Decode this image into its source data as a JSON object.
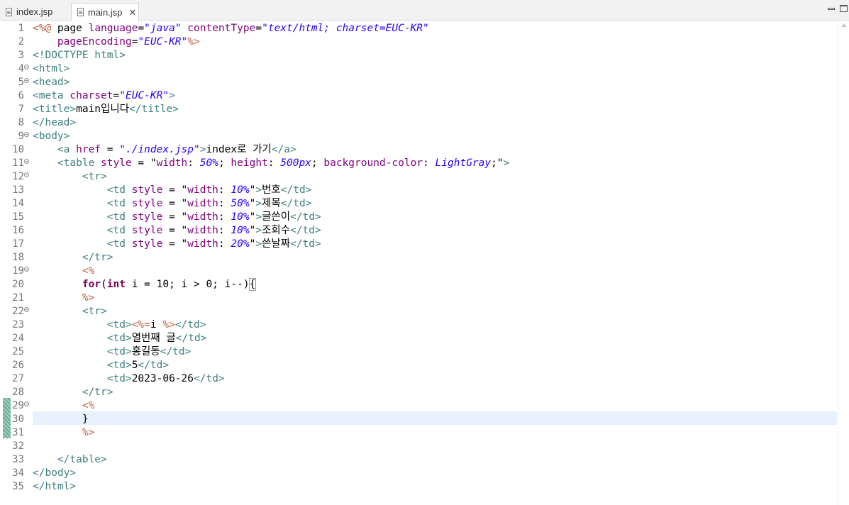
{
  "tabs": [
    {
      "label": "index.jsp",
      "active": false
    },
    {
      "label": "main.jsp",
      "active": true
    }
  ],
  "window_controls": [
    "minimize-icon",
    "maximize-icon"
  ],
  "icons": {
    "file": "file-icon",
    "close": "close-icon",
    "fold": "fold-toggle-icon"
  },
  "colors": {
    "tag": "#3f7f7f",
    "attribute": "#7f007f",
    "string": "#2a00ff",
    "directive": "#bf5f3f",
    "keyword": "#7f0055",
    "current_line": "#e8f2fe",
    "change_marker": "#6eaa98"
  },
  "editor": {
    "current_line_number": "30",
    "changed_lines": [
      "29",
      "30",
      "31"
    ],
    "lines": [
      {
        "num": "1",
        "fold": false,
        "tokens": [
          {
            "t": "<%@",
            "k": "dir"
          },
          {
            "t": " page ",
            "k": "plain"
          },
          {
            "t": "language",
            "k": "attr"
          },
          {
            "t": "=",
            "k": "plain"
          },
          {
            "t": "\"java\"",
            "k": "str"
          },
          {
            "t": " ",
            "k": "plain"
          },
          {
            "t": "contentType",
            "k": "attr"
          },
          {
            "t": "=",
            "k": "plain"
          },
          {
            "t": "\"text/html; charset=EUC-KR\"",
            "k": "str"
          }
        ]
      },
      {
        "num": "2",
        "fold": false,
        "tokens": [
          {
            "t": "    ",
            "k": "plain"
          },
          {
            "t": "pageEncoding",
            "k": "attr"
          },
          {
            "t": "=",
            "k": "plain"
          },
          {
            "t": "\"EUC-KR\"",
            "k": "str"
          },
          {
            "t": "%>",
            "k": "dir"
          }
        ]
      },
      {
        "num": "3",
        "fold": false,
        "tokens": [
          {
            "t": "<!DOCTYPE html>",
            "k": "tag"
          }
        ]
      },
      {
        "num": "4",
        "fold": true,
        "tokens": [
          {
            "t": "<html>",
            "k": "tag"
          }
        ]
      },
      {
        "num": "5",
        "fold": true,
        "tokens": [
          {
            "t": "<head>",
            "k": "tag"
          }
        ]
      },
      {
        "num": "6",
        "fold": false,
        "tokens": [
          {
            "t": "<meta ",
            "k": "tag"
          },
          {
            "t": "charset",
            "k": "attr"
          },
          {
            "t": "=",
            "k": "plain"
          },
          {
            "t": "\"EUC-KR\"",
            "k": "str"
          },
          {
            "t": ">",
            "k": "tag"
          }
        ]
      },
      {
        "num": "7",
        "fold": false,
        "tokens": [
          {
            "t": "<title>",
            "k": "tag"
          },
          {
            "t": "main입니다",
            "k": "plain"
          },
          {
            "t": "</title>",
            "k": "tag"
          }
        ]
      },
      {
        "num": "8",
        "fold": false,
        "tokens": [
          {
            "t": "</head>",
            "k": "tag"
          }
        ]
      },
      {
        "num": "9",
        "fold": true,
        "tokens": [
          {
            "t": "<body>",
            "k": "tag"
          }
        ]
      },
      {
        "num": "10",
        "fold": false,
        "tokens": [
          {
            "t": "    ",
            "k": "plain"
          },
          {
            "t": "<a ",
            "k": "tag"
          },
          {
            "t": "href",
            "k": "attr"
          },
          {
            "t": " = ",
            "k": "plain"
          },
          {
            "t": "\"./index.jsp\"",
            "k": "str"
          },
          {
            "t": ">",
            "k": "tag"
          },
          {
            "t": "index로 가기",
            "k": "plain"
          },
          {
            "t": "</a>",
            "k": "tag"
          }
        ]
      },
      {
        "num": "11",
        "fold": true,
        "tokens": [
          {
            "t": "    ",
            "k": "plain"
          },
          {
            "t": "<table ",
            "k": "tag"
          },
          {
            "t": "style",
            "k": "attr"
          },
          {
            "t": " = \"",
            "k": "plain"
          },
          {
            "t": "width",
            "k": "attr"
          },
          {
            "t": ": ",
            "k": "plain"
          },
          {
            "t": "50%",
            "k": "cval"
          },
          {
            "t": "; ",
            "k": "plain"
          },
          {
            "t": "height",
            "k": "attr"
          },
          {
            "t": ": ",
            "k": "plain"
          },
          {
            "t": "500px",
            "k": "cval"
          },
          {
            "t": "; ",
            "k": "plain"
          },
          {
            "t": "background-color",
            "k": "attr"
          },
          {
            "t": ": ",
            "k": "plain"
          },
          {
            "t": "LightGray",
            "k": "cval"
          },
          {
            "t": ";\"",
            "k": "plain"
          },
          {
            "t": ">",
            "k": "tag"
          }
        ]
      },
      {
        "num": "12",
        "fold": true,
        "tokens": [
          {
            "t": "        ",
            "k": "plain"
          },
          {
            "t": "<tr>",
            "k": "tag"
          }
        ]
      },
      {
        "num": "13",
        "fold": false,
        "tokens": [
          {
            "t": "            ",
            "k": "plain"
          },
          {
            "t": "<td ",
            "k": "tag"
          },
          {
            "t": "style",
            "k": "attr"
          },
          {
            "t": " = \"",
            "k": "plain"
          },
          {
            "t": "width",
            "k": "attr"
          },
          {
            "t": ": ",
            "k": "plain"
          },
          {
            "t": "10%",
            "k": "cval"
          },
          {
            "t": "\"",
            "k": "plain"
          },
          {
            "t": ">",
            "k": "tag"
          },
          {
            "t": "번호",
            "k": "plain"
          },
          {
            "t": "</td>",
            "k": "tag"
          }
        ]
      },
      {
        "num": "14",
        "fold": false,
        "tokens": [
          {
            "t": "            ",
            "k": "plain"
          },
          {
            "t": "<td ",
            "k": "tag"
          },
          {
            "t": "style",
            "k": "attr"
          },
          {
            "t": " = \"",
            "k": "plain"
          },
          {
            "t": "width",
            "k": "attr"
          },
          {
            "t": ": ",
            "k": "plain"
          },
          {
            "t": "50%",
            "k": "cval"
          },
          {
            "t": "\"",
            "k": "plain"
          },
          {
            "t": ">",
            "k": "tag"
          },
          {
            "t": "제목",
            "k": "plain"
          },
          {
            "t": "</td>",
            "k": "tag"
          }
        ]
      },
      {
        "num": "15",
        "fold": false,
        "tokens": [
          {
            "t": "            ",
            "k": "plain"
          },
          {
            "t": "<td ",
            "k": "tag"
          },
          {
            "t": "style",
            "k": "attr"
          },
          {
            "t": " = \"",
            "k": "plain"
          },
          {
            "t": "width",
            "k": "attr"
          },
          {
            "t": ": ",
            "k": "plain"
          },
          {
            "t": "10%",
            "k": "cval"
          },
          {
            "t": "\"",
            "k": "plain"
          },
          {
            "t": ">",
            "k": "tag"
          },
          {
            "t": "글쓴이",
            "k": "plain"
          },
          {
            "t": "</td>",
            "k": "tag"
          }
        ]
      },
      {
        "num": "16",
        "fold": false,
        "tokens": [
          {
            "t": "            ",
            "k": "plain"
          },
          {
            "t": "<td ",
            "k": "tag"
          },
          {
            "t": "style",
            "k": "attr"
          },
          {
            "t": " = \"",
            "k": "plain"
          },
          {
            "t": "width",
            "k": "attr"
          },
          {
            "t": ": ",
            "k": "plain"
          },
          {
            "t": "10%",
            "k": "cval"
          },
          {
            "t": "\"",
            "k": "plain"
          },
          {
            "t": ">",
            "k": "tag"
          },
          {
            "t": "조회수",
            "k": "plain"
          },
          {
            "t": "</td>",
            "k": "tag"
          }
        ]
      },
      {
        "num": "17",
        "fold": false,
        "tokens": [
          {
            "t": "            ",
            "k": "plain"
          },
          {
            "t": "<td ",
            "k": "tag"
          },
          {
            "t": "style",
            "k": "attr"
          },
          {
            "t": " = \"",
            "k": "plain"
          },
          {
            "t": "width",
            "k": "attr"
          },
          {
            "t": ": ",
            "k": "plain"
          },
          {
            "t": "20%",
            "k": "cval"
          },
          {
            "t": "\"",
            "k": "plain"
          },
          {
            "t": ">",
            "k": "tag"
          },
          {
            "t": "쓴날짜",
            "k": "plain"
          },
          {
            "t": "</td>",
            "k": "tag"
          }
        ]
      },
      {
        "num": "18",
        "fold": false,
        "tokens": [
          {
            "t": "        ",
            "k": "plain"
          },
          {
            "t": "</tr>",
            "k": "tag"
          }
        ]
      },
      {
        "num": "19",
        "fold": true,
        "tokens": [
          {
            "t": "        ",
            "k": "plain"
          },
          {
            "t": "<%",
            "k": "dir"
          }
        ]
      },
      {
        "num": "20",
        "fold": false,
        "tokens": [
          {
            "t": "        ",
            "k": "plain"
          },
          {
            "t": "for",
            "k": "kw"
          },
          {
            "t": "(",
            "k": "plain"
          },
          {
            "t": "int",
            "k": "kw"
          },
          {
            "t": " i = 10; i > 0; i--)",
            "k": "plain"
          },
          {
            "t": "{",
            "k": "bracket"
          }
        ]
      },
      {
        "num": "21",
        "fold": false,
        "tokens": [
          {
            "t": "        ",
            "k": "plain"
          },
          {
            "t": "%>",
            "k": "dir"
          }
        ]
      },
      {
        "num": "22",
        "fold": true,
        "tokens": [
          {
            "t": "        ",
            "k": "plain"
          },
          {
            "t": "<tr>",
            "k": "tag"
          }
        ]
      },
      {
        "num": "23",
        "fold": false,
        "tokens": [
          {
            "t": "            ",
            "k": "plain"
          },
          {
            "t": "<td>",
            "k": "tag"
          },
          {
            "t": "<%=",
            "k": "dir"
          },
          {
            "t": "i ",
            "k": "plain"
          },
          {
            "t": "%>",
            "k": "dir"
          },
          {
            "t": "</td>",
            "k": "tag"
          }
        ]
      },
      {
        "num": "24",
        "fold": false,
        "tokens": [
          {
            "t": "            ",
            "k": "plain"
          },
          {
            "t": "<td>",
            "k": "tag"
          },
          {
            "t": "열번째 글",
            "k": "plain"
          },
          {
            "t": "</td>",
            "k": "tag"
          }
        ]
      },
      {
        "num": "25",
        "fold": false,
        "tokens": [
          {
            "t": "            ",
            "k": "plain"
          },
          {
            "t": "<td>",
            "k": "tag"
          },
          {
            "t": "홍길동",
            "k": "plain"
          },
          {
            "t": "</td>",
            "k": "tag"
          }
        ]
      },
      {
        "num": "26",
        "fold": false,
        "tokens": [
          {
            "t": "            ",
            "k": "plain"
          },
          {
            "t": "<td>",
            "k": "tag"
          },
          {
            "t": "5",
            "k": "plain"
          },
          {
            "t": "</td>",
            "k": "tag"
          }
        ]
      },
      {
        "num": "27",
        "fold": false,
        "tokens": [
          {
            "t": "            ",
            "k": "plain"
          },
          {
            "t": "<td>",
            "k": "tag"
          },
          {
            "t": "2023-06-26",
            "k": "plain"
          },
          {
            "t": "</td>",
            "k": "tag"
          }
        ]
      },
      {
        "num": "28",
        "fold": false,
        "tokens": [
          {
            "t": "        ",
            "k": "plain"
          },
          {
            "t": "</tr>",
            "k": "tag"
          }
        ]
      },
      {
        "num": "29",
        "fold": true,
        "tokens": [
          {
            "t": "        ",
            "k": "plain"
          },
          {
            "t": "<%",
            "k": "dir"
          }
        ]
      },
      {
        "num": "30",
        "fold": false,
        "tokens": [
          {
            "t": "        ",
            "k": "plain"
          },
          {
            "t": "}",
            "k": "plain"
          }
        ]
      },
      {
        "num": "31",
        "fold": false,
        "tokens": [
          {
            "t": "        ",
            "k": "plain"
          },
          {
            "t": "%>",
            "k": "dir"
          }
        ]
      },
      {
        "num": "32",
        "fold": false,
        "tokens": []
      },
      {
        "num": "33",
        "fold": false,
        "tokens": [
          {
            "t": "    ",
            "k": "plain"
          },
          {
            "t": "</table>",
            "k": "tag"
          }
        ]
      },
      {
        "num": "34",
        "fold": false,
        "tokens": [
          {
            "t": "</body>",
            "k": "tag"
          }
        ]
      },
      {
        "num": "35",
        "fold": false,
        "tokens": [
          {
            "t": "</html>",
            "k": "tag"
          }
        ]
      }
    ]
  }
}
